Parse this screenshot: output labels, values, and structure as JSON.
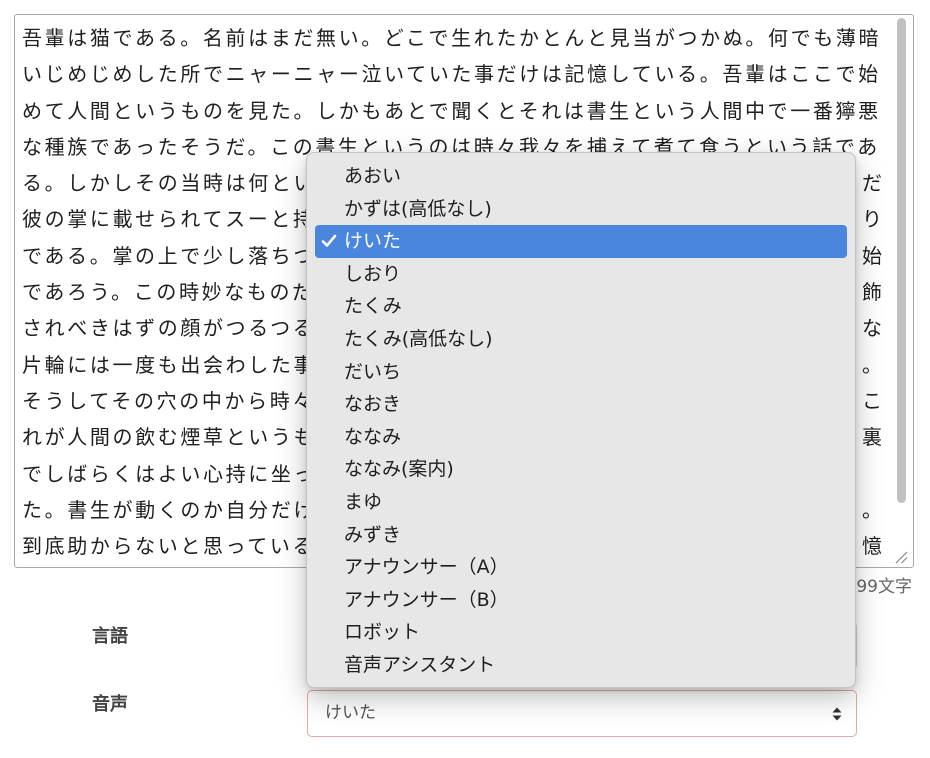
{
  "editor": {
    "lines": [
      {
        "left": "吾輩は猫である。名前はまだ無い。どこで生れたかとんと見当がつかぬ。何でも薄暗"
      },
      {
        "left": "いじめじめした所でニャーニャー泣いていた事だけは記憶している。吾輩はここで始"
      },
      {
        "left": "めて人間というものを見た。しかもあとで聞くとそれは書生という人間中で一番獰悪"
      },
      {
        "left": "な種族であったそうだ。この書生というのは時々我々を捕えて煮て食うという話であ"
      },
      {
        "left": "る。しかしその当時は何とい",
        "right": "だ"
      },
      {
        "left": "彼の掌に載せられてスーと持",
        "right": "り"
      },
      {
        "left": "である。掌の上で少し落ちつ",
        "right": "始"
      },
      {
        "left": "であろう。この時妙なものだ",
        "right": "飾"
      },
      {
        "left": "されべきはずの顔がつるつる",
        "right": "な"
      },
      {
        "left": "片輪には一度も出会わした事",
        "right": "。"
      },
      {
        "left": "そうしてその穴の中から時々",
        "right": "こ"
      },
      {
        "left": "れが人間の飲む煙草というも",
        "right": "裏"
      },
      {
        "left": "でしばらくはよい心持に坐っ"
      },
      {
        "left": "た。書生が動くのか自分だけ",
        "right": "。"
      },
      {
        "left": "到底助からないと思っている",
        "right": "憶"
      }
    ],
    "char_count": "99文字"
  },
  "form": {
    "language": {
      "label": "言語"
    },
    "voice": {
      "label": "音声",
      "value": "けいた"
    }
  },
  "voice_menu": {
    "items": [
      "あおい",
      "かずは(高低なし)",
      "けいた",
      "しおり",
      "たくみ",
      "たくみ(高低なし)",
      "だいち",
      "なおき",
      "ななみ",
      "ななみ(案内)",
      "まゆ",
      "みずき",
      "アナウンサー（A）",
      "アナウンサー（B）",
      "ロボット",
      "音声アシスタント"
    ],
    "selected_index": 2
  },
  "icons": {
    "selected_mark": "check-icon",
    "select_arrows": "select-arrows-icon",
    "resize_grip": "resize-handle-icon"
  },
  "colors": {
    "menu_highlight": "#4a86de",
    "voice_select_border": "#e8a5a5"
  }
}
